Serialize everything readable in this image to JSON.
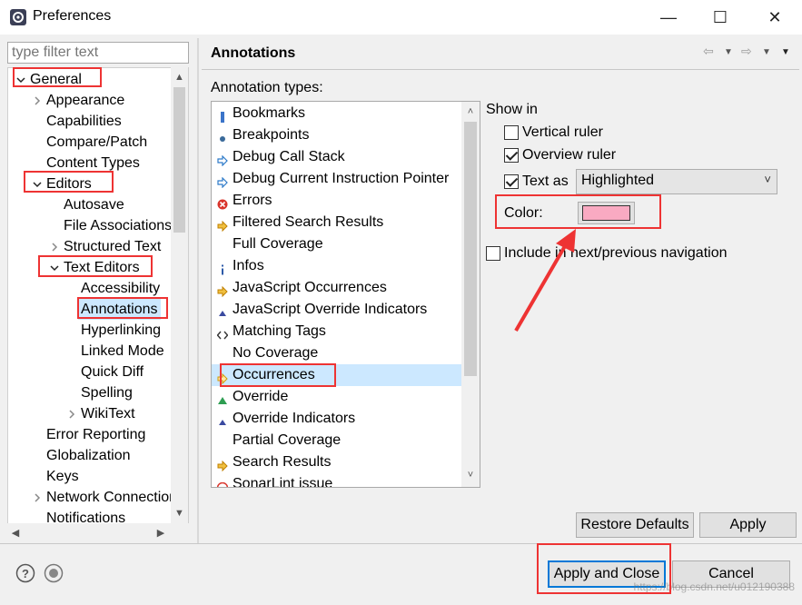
{
  "window": {
    "title": "Preferences",
    "min": "—",
    "max": "☐",
    "close": "✕"
  },
  "filter": {
    "placeholder": "type filter text"
  },
  "tree": [
    {
      "label": "General",
      "depth": 0,
      "twisty": "open"
    },
    {
      "label": "Appearance",
      "depth": 1,
      "twisty": "closed"
    },
    {
      "label": "Capabilities",
      "depth": 1,
      "twisty": ""
    },
    {
      "label": "Compare/Patch",
      "depth": 1,
      "twisty": ""
    },
    {
      "label": "Content Types",
      "depth": 1,
      "twisty": ""
    },
    {
      "label": "Editors",
      "depth": 1,
      "twisty": "open"
    },
    {
      "label": "Autosave",
      "depth": 2,
      "twisty": ""
    },
    {
      "label": "File Associations",
      "depth": 2,
      "twisty": ""
    },
    {
      "label": "Structured Text",
      "depth": 2,
      "twisty": "closed"
    },
    {
      "label": "Text Editors",
      "depth": 2,
      "twisty": "open"
    },
    {
      "label": "Accessibility",
      "depth": 3,
      "twisty": ""
    },
    {
      "label": "Annotations",
      "depth": 3,
      "twisty": "",
      "selected": true
    },
    {
      "label": "Hyperlinking",
      "depth": 3,
      "twisty": ""
    },
    {
      "label": "Linked Mode",
      "depth": 3,
      "twisty": ""
    },
    {
      "label": "Quick Diff",
      "depth": 3,
      "twisty": ""
    },
    {
      "label": "Spelling",
      "depth": 3,
      "twisty": ""
    },
    {
      "label": "WikiText",
      "depth": 3,
      "twisty": "closed"
    },
    {
      "label": "Error Reporting",
      "depth": 1,
      "twisty": ""
    },
    {
      "label": "Globalization",
      "depth": 1,
      "twisty": ""
    },
    {
      "label": "Keys",
      "depth": 1,
      "twisty": ""
    },
    {
      "label": "Network Connections",
      "depth": 1,
      "twisty": "closed"
    },
    {
      "label": "Notifications",
      "depth": 1,
      "twisty": ""
    }
  ],
  "page": {
    "title": "Annotations",
    "annotation_types_label": "Annotation types:",
    "annotation_types": [
      {
        "label": "Bookmarks",
        "icon": "bookmark-icon"
      },
      {
        "label": "Breakpoints",
        "icon": "breakpoint-icon"
      },
      {
        "label": "Debug Call Stack",
        "icon": "arrow-icon"
      },
      {
        "label": "Debug Current Instruction Pointer",
        "icon": "arrow-icon"
      },
      {
        "label": "Errors",
        "icon": "error-icon"
      },
      {
        "label": "Filtered Search Results",
        "icon": "search-arrow-icon"
      },
      {
        "label": "Full Coverage",
        "icon": ""
      },
      {
        "label": "Infos",
        "icon": "info-icon"
      },
      {
        "label": "JavaScript Occurrences",
        "icon": "search-arrow-icon"
      },
      {
        "label": "JavaScript Override Indicators",
        "icon": "override-icon"
      },
      {
        "label": "Matching Tags",
        "icon": "tags-icon"
      },
      {
        "label": "No Coverage",
        "icon": ""
      },
      {
        "label": "Occurrences",
        "icon": "occurrence-icon",
        "selected": true
      },
      {
        "label": "Override",
        "icon": "green-triangle-icon"
      },
      {
        "label": "Override Indicators",
        "icon": "override-icon"
      },
      {
        "label": "Partial Coverage",
        "icon": ""
      },
      {
        "label": "Search Results",
        "icon": "search-arrow-icon"
      },
      {
        "label": "SonarLint issue",
        "icon": "sonarlint-icon"
      }
    ],
    "show_in_label": "Show in",
    "vertical_ruler": {
      "label": "Vertical ruler",
      "checked": false
    },
    "overview_ruler": {
      "label": "Overview ruler",
      "checked": true
    },
    "text_as": {
      "label": "Text as",
      "checked": true,
      "value": "Highlighted"
    },
    "color_label": "Color:",
    "color_value": "#f9aac2",
    "include_nav": {
      "label": "Include in next/previous navigation",
      "checked": false
    },
    "restore_defaults": "Restore Defaults",
    "apply": "Apply"
  },
  "footer": {
    "apply_and_close": "Apply and Close",
    "cancel": "Cancel"
  },
  "watermark": "https://blog.csdn.net/u012190388"
}
